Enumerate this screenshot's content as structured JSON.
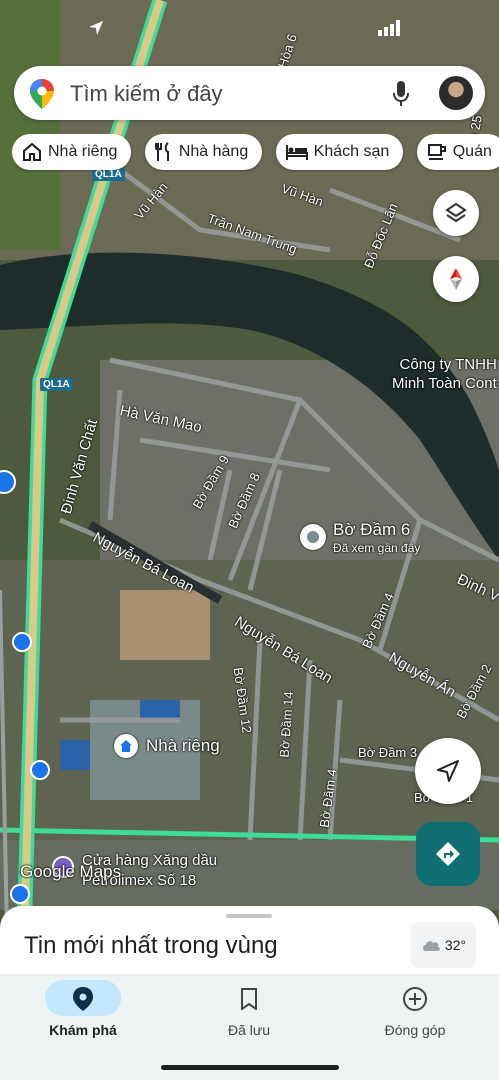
{
  "search": {
    "placeholder": "Tìm kiếm ở đây"
  },
  "chips": [
    {
      "label": "Nhà riêng",
      "icon": "home-icon"
    },
    {
      "label": "Nhà hàng",
      "icon": "restaurant-icon"
    },
    {
      "label": "Khách sạn",
      "icon": "hotel-icon"
    },
    {
      "label": "Quán",
      "icon": "cafe-icon"
    }
  ],
  "map": {
    "roads": {
      "hoa6": "Hòa 6",
      "lien25": "Liên 25",
      "vuhan1": "Vũ Hàn",
      "vuhan2": "Vũ Hàn",
      "trannamtrung": "Trần Nam Trung",
      "dodoclan": "Đỗ Đốc Lân",
      "havanmao": "Hà Văn Mao",
      "dinhvanchat": "Đinh Văn Chất",
      "bodam9": "Bờ Đầm 9",
      "bodam8": "Bờ Đầm 8",
      "nguyenbaloan1": "Nguyễn Bá Loan",
      "nguyenbaloan2": "Nguyễn Bá Loan",
      "bodam4a": "Bờ Đầm 4",
      "nguyenan": "Nguyễn Án",
      "dinhv": "Đinh V",
      "bodam2": "Bờ Đầm 2",
      "bodam12": "Bờ Đầm 12",
      "bodam14": "Bờ Đầm 14",
      "bodam3": "Bờ Đầm 3",
      "bodam4b": "Bờ Đầm 4",
      "bodam1": "Bờ Đầm 1"
    },
    "highway_shields": [
      "QL1A",
      "QL1A"
    ],
    "company_line1": "Công ty TNHH",
    "company_line2": "Minh Toàn Cont",
    "place_bodam6": "Bờ Đầm 6",
    "place_bodam6_sub": "Đã xem gần đây",
    "home_label": "Nhà riêng",
    "gas_line1": "Cửa hàng Xăng dầu",
    "gas_line2": "Petrolimex Số 18",
    "watermark": "Google Maps"
  },
  "sheet": {
    "title": "Tin mới nhất trong vùng"
  },
  "weather": {
    "temp": "32°",
    "icon": "cloud-icon"
  },
  "nav": [
    {
      "label": "Khám phá",
      "icon": "location-pin-icon",
      "active": true
    },
    {
      "label": "Đã lưu",
      "icon": "bookmark-icon",
      "active": false
    },
    {
      "label": "Đóng góp",
      "icon": "add-circle-icon",
      "active": false
    }
  ],
  "colors": {
    "accent": "#0f6e71",
    "active_pill": "#c2e7ff",
    "highway": "#3ddc97"
  }
}
